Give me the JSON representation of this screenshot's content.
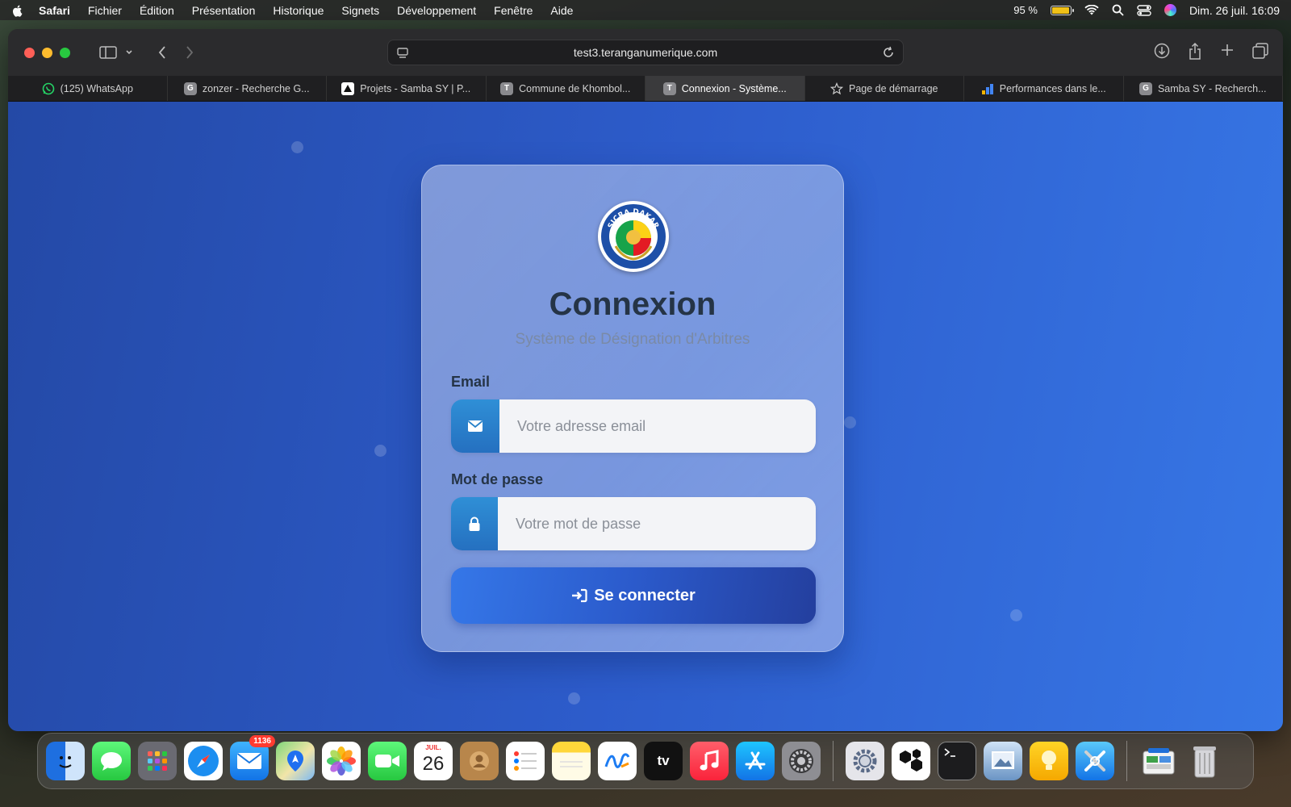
{
  "menubar": {
    "app": "Safari",
    "items": [
      "Fichier",
      "Édition",
      "Présentation",
      "Historique",
      "Signets",
      "Développement",
      "Fenêtre",
      "Aide"
    ],
    "battery": "95 %",
    "battery_level": 0.95,
    "datetime": "Dim. 26 juil.  16:09"
  },
  "browser": {
    "url": "test3.teranganumerique.com",
    "tabs": [
      {
        "label": "(125) WhatsApp",
        "icon": "whatsapp-icon"
      },
      {
        "label": "zonzer - Recherche G...",
        "icon": "G"
      },
      {
        "label": "Projets - Samba SY | P...",
        "icon": "projets-icon"
      },
      {
        "label": "Commune de Khombol...",
        "icon": "T"
      },
      {
        "label": "Connexion - Système...",
        "icon": "T",
        "active": true
      },
      {
        "label": "Page de démarrage",
        "icon": "star-icon"
      },
      {
        "label": "Performances dans le...",
        "icon": "analytics-icon"
      },
      {
        "label": "Samba SY - Recherch...",
        "icon": "G"
      }
    ]
  },
  "login": {
    "logo_alt": "SICRA DAKAR",
    "title": "Connexion",
    "subtitle": "Système de Désignation d'Arbitres",
    "email_label": "Email",
    "email_placeholder": "Votre adresse email",
    "password_label": "Mot de passe",
    "password_placeholder": "Votre mot de passe",
    "submit_label": "Se connecter"
  },
  "dock": {
    "mail_badge": "1136",
    "calendar_month": "JUIL.",
    "calendar_day": "26"
  },
  "colors": {
    "page_bg_start": "#2449a6",
    "page_bg_end": "#3777e6",
    "icon_bg": "#2f8fd6",
    "title": "#253446",
    "button": "#2b5acb"
  }
}
